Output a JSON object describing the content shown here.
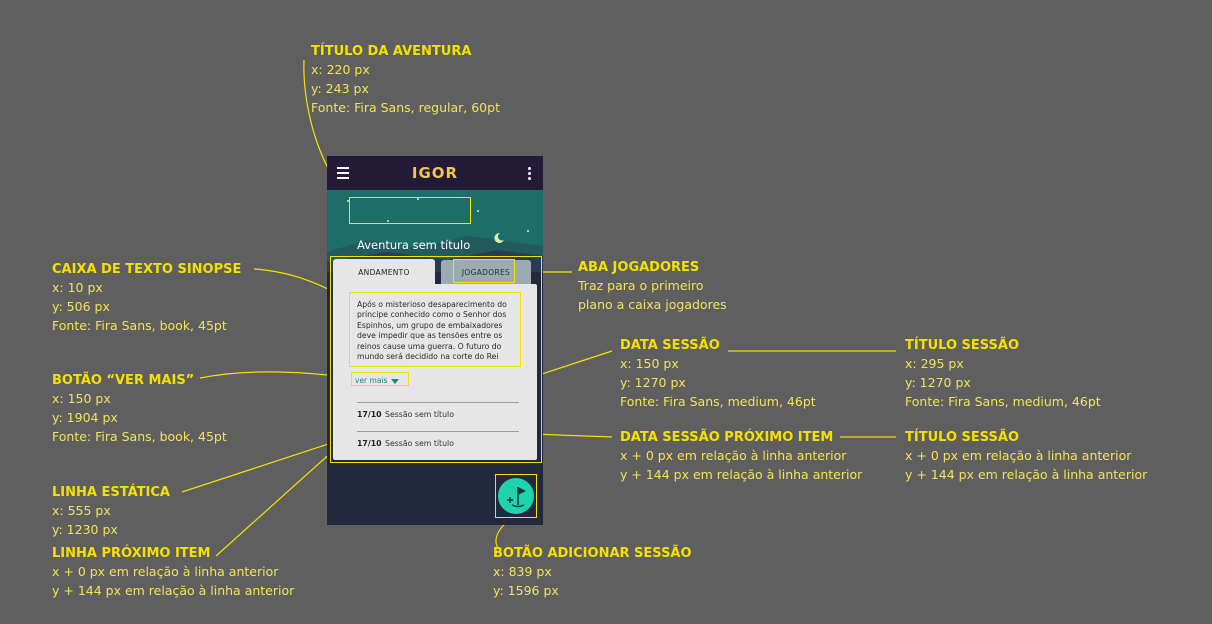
{
  "app": {
    "logo": "IGOR",
    "adventure_title": "Aventura sem título",
    "tabs": [
      "ANDAMENTO",
      "JOGADORES"
    ],
    "synopsis": "Após o misterioso desaparecimento do príncipe conhecido como o Senhor dos Espinhos, um grupo de embaixadores deve impedir que as tensões entre os reinos cause uma guerra. O futuro do mundo será decidido na corte do Rei",
    "see_more": "ver mais",
    "sessions": [
      {
        "date": "17/10",
        "title": "Sessão sem título"
      },
      {
        "date": "17/10",
        "title": "Sessão sem título"
      }
    ]
  },
  "annotations": {
    "titulo_aventura": {
      "title": "TÍTULO DA AVENTURA",
      "lines": [
        "x: 220 px",
        "y: 243 px",
        "Fonte: Fira Sans, regular, 60pt"
      ]
    },
    "caixa_sinopse": {
      "title": "CAIXA DE TEXTO SINOPSE",
      "lines": [
        "x: 10 px",
        "y: 506 px",
        "Fonte: Fira Sans, book, 45pt"
      ]
    },
    "botao_ver_mais": {
      "title": "BOTÃO “VER MAIS”",
      "lines": [
        "x: 150 px",
        "y: 1904 px",
        "Fonte: Fira Sans, book, 45pt"
      ]
    },
    "linha_estatica": {
      "title": "LINHA ESTÁTICA",
      "lines": [
        "x: 555 px",
        "y: 1230 px"
      ]
    },
    "linha_proximo": {
      "title": "LINHA PRÓXIMO ITEM",
      "lines": [
        "x + 0 px em relação à linha anterior",
        "y + 144 px em relação à linha anterior"
      ]
    },
    "aba_jogadores": {
      "title": "ABA JOGADORES",
      "lines": [
        "Traz para o primeiro",
        "plano a caixa jogadores"
      ]
    },
    "data_sessao": {
      "title": "DATA SESSÃO",
      "lines": [
        "x: 150 px",
        "y: 1270 px",
        "Fonte: Fira Sans, medium, 46pt"
      ]
    },
    "titulo_sessao": {
      "title": "TÍTULO SESSÃO",
      "lines": [
        "x: 295 px",
        "y: 1270 px",
        "Fonte: Fira Sans, medium, 46pt"
      ]
    },
    "data_sessao_proximo": {
      "title": "DATA SESSÃO PRÓXIMO ITEM",
      "lines": [
        "x + 0 px em relação à linha anterior",
        "y + 144 px em relação à linha anterior"
      ]
    },
    "titulo_sessao_proximo": {
      "title": "TÍTULO SESSÃO",
      "lines": [
        "x + 0 px em relação à linha anterior",
        "y + 144 px em relação à linha anterior"
      ]
    },
    "botao_adicionar": {
      "title": "BOTÃO ADICIONAR SESSÃO",
      "lines": [
        "x: 839 px",
        "y: 1596 px"
      ]
    }
  },
  "colors": {
    "background": "#5f5f5f",
    "annotation": "#f5e100",
    "app_bar": "#221a36",
    "hero": "#1d6d68",
    "accent": "#1fd3b0",
    "logo": "#f0c64d"
  }
}
